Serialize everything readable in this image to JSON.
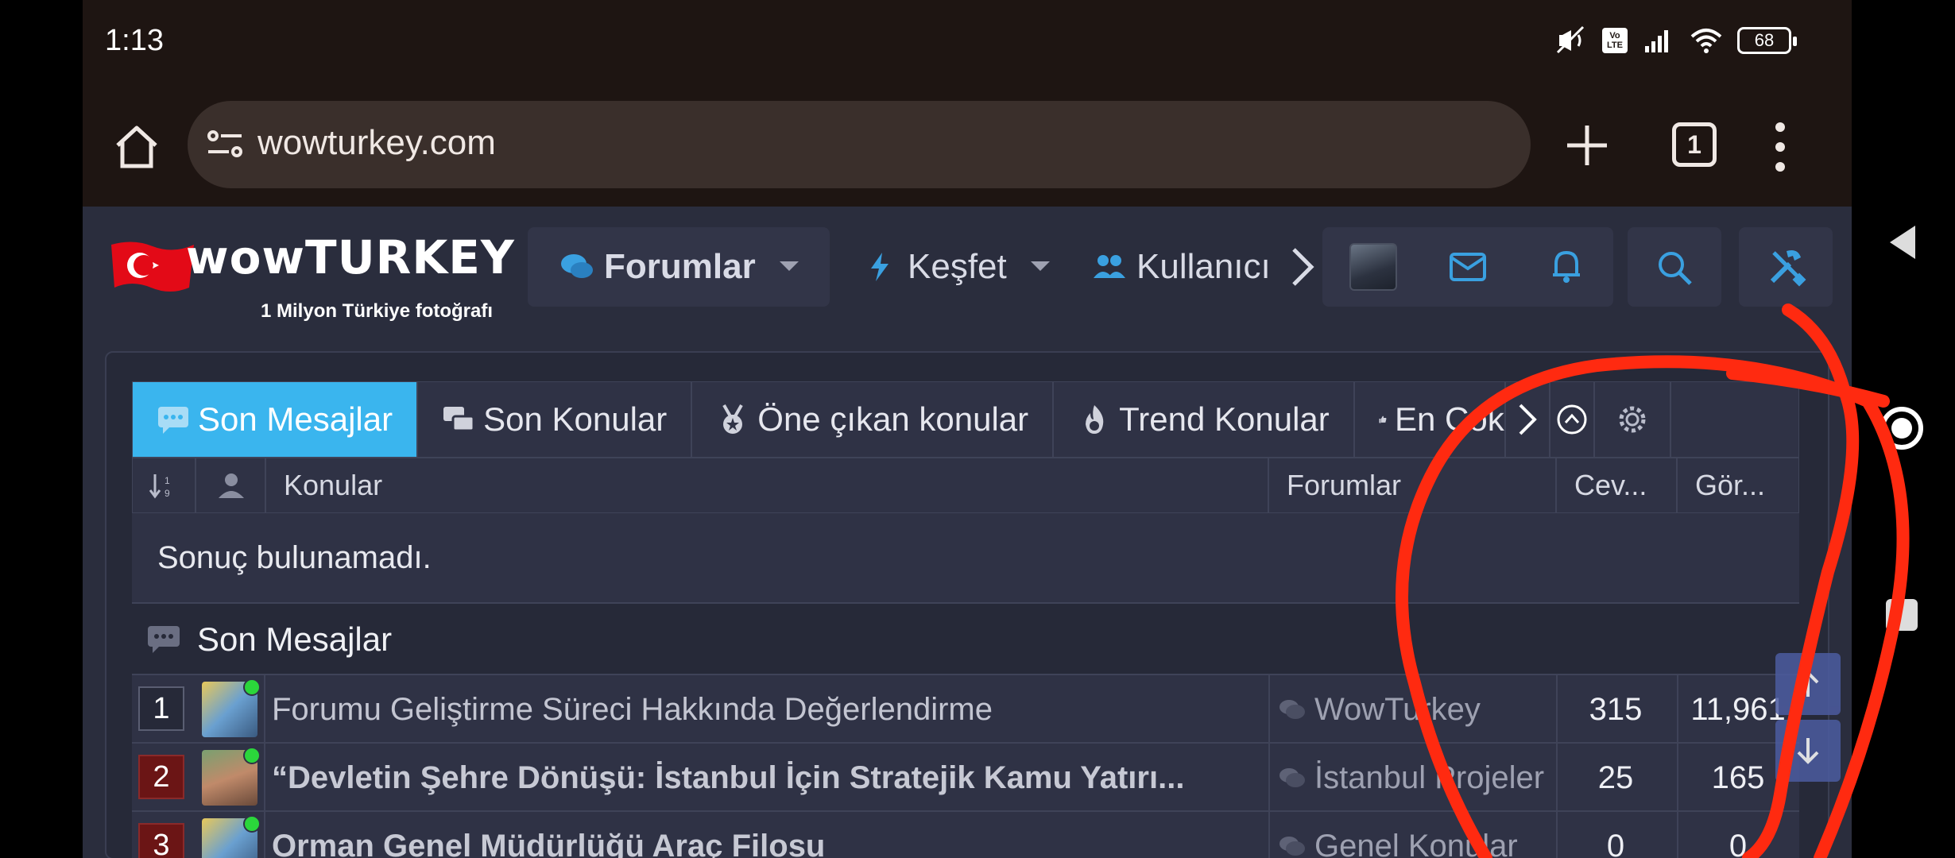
{
  "status_bar": {
    "time": "1:13",
    "network_badge": "Vo LTE",
    "battery": "68"
  },
  "browser": {
    "url": "wowturkey.com",
    "tab_count": "1"
  },
  "site": {
    "brand": "wowTURKEY",
    "tagline": "1 Milyon Türkiye fotoğrafı",
    "nav": {
      "forumlar": "Forumlar",
      "kesfet": "Keşfet",
      "kullanicilar": "Kullanıcı"
    }
  },
  "widget": {
    "tabs": [
      "Son Mesajlar",
      "Son Konular",
      "Öne çıkan konular",
      "Trend Konular",
      "En Çok"
    ],
    "columns": {
      "konular": "Konular",
      "forumlar": "Forumlar",
      "cevap": "Cev...",
      "goruntulenme": "Gör..."
    },
    "no_result": "Sonuç bulunamadı.",
    "section_title": "Son Mesajlar",
    "rows": [
      {
        "rank": "1",
        "title": "Forumu Geliştirme Süreci Hakkında Değerlendirme",
        "forum": "WowTurkey",
        "replies": "315",
        "views": "11,961"
      },
      {
        "rank": "2",
        "title": "“Devletin Şehre Dönüşü: İstanbul İçin Stratejik Kamu Yatırı...",
        "forum": "İstanbul Projeler",
        "replies": "25",
        "views": "165"
      },
      {
        "rank": "3",
        "title": "Orman Genel Müdürlüğü Araç Filosu",
        "forum": "Genel Konular",
        "replies": "0",
        "views": "0"
      }
    ]
  },
  "colors": {
    "accent": "#3ab5ee",
    "annotation": "#ff2a10",
    "online": "#2bd63b"
  }
}
